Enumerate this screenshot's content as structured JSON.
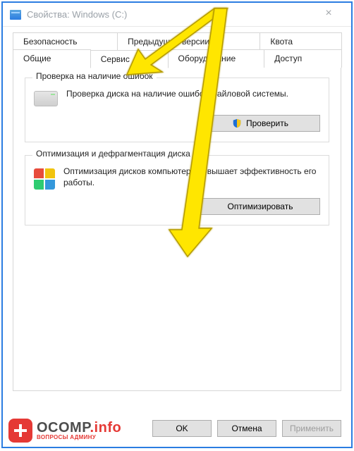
{
  "window": {
    "title": "Свойства: Windows (C:)"
  },
  "tabs": {
    "row1": [
      {
        "label": "Безопасность"
      },
      {
        "label": "Предыдущие версии"
      },
      {
        "label": "Квота"
      }
    ],
    "row2": [
      {
        "label": "Общие"
      },
      {
        "label": "Сервис",
        "active": true
      },
      {
        "label": "Оборудование"
      },
      {
        "label": "Доступ"
      }
    ]
  },
  "section_errcheck": {
    "title": "Проверка на наличие ошибок",
    "text": "Проверка диска на наличие ошибок файловой системы.",
    "button": "Проверить"
  },
  "section_optimize": {
    "title": "Оптимизация и дефрагментация диска",
    "text": "Оптимизация дисков компьютера повышает эффективность его работы.",
    "button": "Оптимизировать"
  },
  "footer": {
    "ok": "OK",
    "cancel": "Отмена",
    "apply": "Применить"
  },
  "watermark": {
    "brand_main": "OCOMP",
    "brand_suffix": ".info",
    "sub": "ВОПРОСЫ АДМИНУ"
  }
}
